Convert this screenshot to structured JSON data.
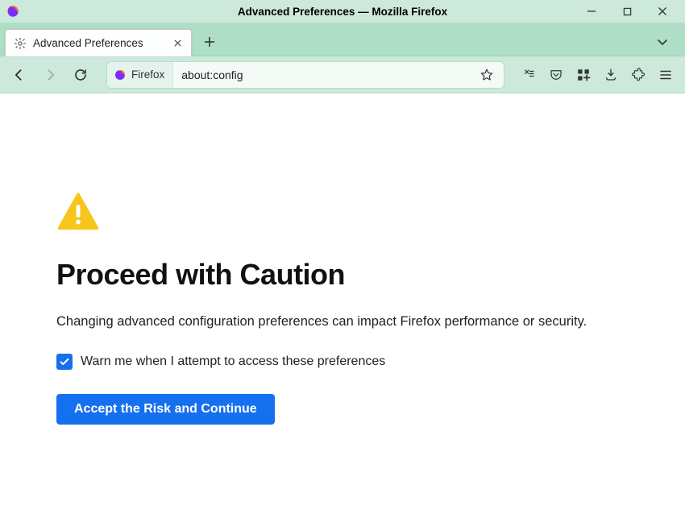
{
  "titlebar": {
    "title": "Advanced Preferences — Mozilla Firefox"
  },
  "tab": {
    "label": "Advanced Preferences"
  },
  "addressbar": {
    "identity_label": "Firefox",
    "url": "about:config"
  },
  "content": {
    "heading": "Proceed with Caution",
    "body": "Changing advanced configuration preferences can impact Firefox performance or security.",
    "checkbox_label": "Warn me when I attempt to access these preferences",
    "checkbox_checked": true,
    "accept_label": "Accept the Risk and Continue"
  },
  "colors": {
    "accent": "#1570ef",
    "chrome_bg": "#cce9db",
    "tabstrip_bg": "#aedfc6",
    "warning": "#f8c51c"
  }
}
